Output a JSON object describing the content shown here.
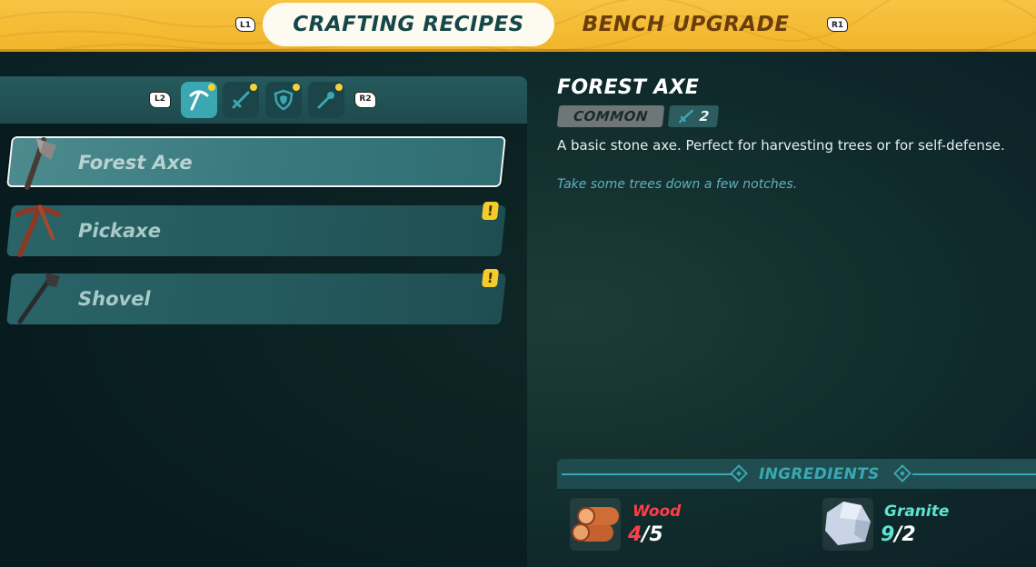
{
  "topbar": {
    "left_hint": "L1",
    "right_hint": "R1",
    "tabs": [
      {
        "label": "CRAFTING RECIPES",
        "active": true
      },
      {
        "label": "BENCH UPGRADE",
        "active": false
      }
    ],
    "colors": {
      "bar": "#f2b42a",
      "active_tab_text": "#15474a",
      "inactive_tab_text": "#6b3d0c"
    }
  },
  "categories": {
    "prev_hint": "L2",
    "next_hint": "R2",
    "items": [
      {
        "icon": "pickaxe-icon",
        "active": true,
        "notify": true
      },
      {
        "icon": "sword-icon",
        "active": false,
        "notify": true
      },
      {
        "icon": "shield-icon",
        "active": false,
        "notify": true
      },
      {
        "icon": "torch-icon",
        "active": false,
        "notify": true
      }
    ]
  },
  "recipes": [
    {
      "label": "Forest Axe",
      "icon": "axe-icon",
      "selected": true,
      "alert": ""
    },
    {
      "label": "Pickaxe",
      "icon": "pickaxe-icon",
      "selected": false,
      "alert": "!"
    },
    {
      "label": "Shovel",
      "icon": "shovel-icon",
      "selected": false,
      "alert": "!"
    }
  ],
  "detail": {
    "title": "FOREST AXE",
    "rarity": "COMMON",
    "power": "2",
    "description": "A basic stone axe. Perfect for harvesting trees or for self-defense.",
    "flavor": "Take some trees down a few notches."
  },
  "ingredients": {
    "title": "INGREDIENTS",
    "items": [
      {
        "name": "Wood",
        "have": "4",
        "need": "/5",
        "enough": false,
        "icon": "wood-logs-icon",
        "name_color": "#ff3d4a"
      },
      {
        "name": "Granite",
        "have": "9",
        "need": "/2",
        "enough": true,
        "icon": "granite-icon",
        "name_color": "#5de5cf"
      }
    ]
  }
}
